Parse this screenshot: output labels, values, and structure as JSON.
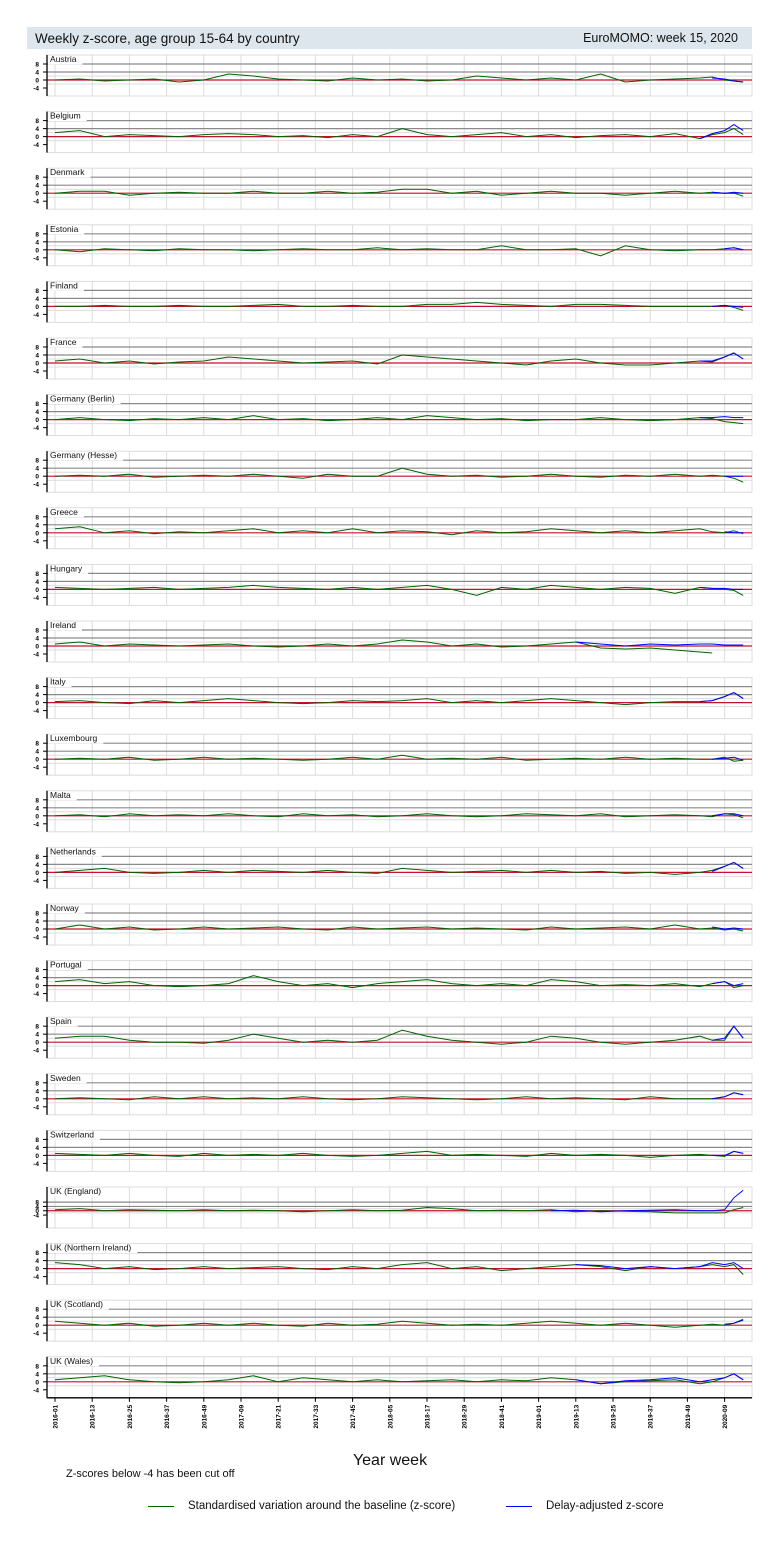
{
  "header": {
    "title": "Weekly z-score, age group 15-64 by country",
    "edition": "EuroMOMO: week 15, 2020"
  },
  "chart_data": {
    "type": "line",
    "title": "Weekly z-score, age group 15-64 by country",
    "xlabel": "Year week",
    "ylabel": "",
    "note": "Z-scores below -4 has been cut off",
    "x_unit": "weeks since 2016-01",
    "x_ticks": [
      {
        "week": 0,
        "label": "2016-01"
      },
      {
        "week": 12,
        "label": "2016-13"
      },
      {
        "week": 24,
        "label": "2016-25"
      },
      {
        "week": 36,
        "label": "2016-37"
      },
      {
        "week": 48,
        "label": "2016-49"
      },
      {
        "week": 60,
        "label": "2017-09"
      },
      {
        "week": 72,
        "label": "2017-21"
      },
      {
        "week": 84,
        "label": "2017-33"
      },
      {
        "week": 96,
        "label": "2017-45"
      },
      {
        "week": 108,
        "label": "2018-05"
      },
      {
        "week": 120,
        "label": "2018-17"
      },
      {
        "week": 132,
        "label": "2018-29"
      },
      {
        "week": 144,
        "label": "2018-41"
      },
      {
        "week": 156,
        "label": "2019-01"
      },
      {
        "week": 168,
        "label": "2019-13"
      },
      {
        "week": 180,
        "label": "2019-25"
      },
      {
        "week": 192,
        "label": "2019-37"
      },
      {
        "week": 204,
        "label": "2019-49"
      },
      {
        "week": 216,
        "label": "2020-09"
      }
    ],
    "y_ticks": [
      8,
      4,
      0,
      -4
    ],
    "ylim": [
      -8,
      12.5
    ],
    "xlim": [
      0,
      224
    ],
    "legend": [
      {
        "name": "Standardised variation around the baseline (z-score)",
        "color": "#006400"
      },
      {
        "name": "Delay-adjusted z-score",
        "color": "#0000ff"
      }
    ],
    "baseline_color": "#c8102e",
    "x": [
      0,
      8,
      16,
      24,
      32,
      40,
      48,
      56,
      64,
      72,
      80,
      88,
      96,
      104,
      112,
      120,
      128,
      136,
      144,
      152,
      160,
      168,
      176,
      184,
      192,
      200,
      208,
      212,
      216,
      219,
      222
    ],
    "panels": [
      {
        "name": "Austria",
        "z": [
          0,
          0.5,
          -0.5,
          0,
          0.5,
          -1,
          0,
          3,
          2,
          0.5,
          0,
          -0.5,
          1,
          0,
          0.5,
          -0.5,
          0,
          2,
          1,
          0,
          1,
          0,
          3,
          -1,
          0,
          0.5,
          1,
          1.5,
          0,
          -0.5,
          -1
        ],
        "delay_start": 27,
        "delay": [
          1,
          0.5,
          -0.5,
          -1
        ]
      },
      {
        "name": "Belgium",
        "z": [
          2,
          3,
          0,
          1,
          0.5,
          0,
          1,
          1.5,
          1,
          0,
          0.5,
          -0.5,
          1,
          0,
          4,
          1,
          0,
          1,
          2,
          0,
          1,
          -0.5,
          0.5,
          1,
          0,
          1.5,
          -1,
          1,
          2,
          4,
          1
        ],
        "delay_start": 26,
        "delay": [
          -1,
          1.5,
          3,
          6,
          3
        ]
      },
      {
        "name": "Denmark",
        "z": [
          0,
          1,
          1,
          -1,
          0,
          0.5,
          0,
          0,
          1,
          0,
          0,
          1,
          0,
          0.5,
          2,
          2,
          0,
          1,
          -1,
          0,
          1,
          0,
          0,
          -1,
          0,
          1,
          0,
          0.5,
          0,
          0,
          -1.5
        ],
        "delay_start": 27,
        "delay": [
          0.5,
          0,
          0.5,
          0
        ]
      },
      {
        "name": "Estonia",
        "z": [
          0,
          -1,
          0.5,
          0,
          -0.5,
          0.5,
          0,
          0,
          -0.5,
          0,
          0.5,
          0,
          0,
          1,
          0,
          0.5,
          0,
          0,
          2,
          0,
          0,
          0.5,
          -3,
          2,
          0,
          -0.5,
          0,
          0,
          0.5,
          1,
          0
        ],
        "delay_start": 28,
        "delay": [
          0.5,
          1,
          0
        ]
      },
      {
        "name": "Finland",
        "z": [
          0,
          0,
          0.5,
          0,
          0,
          0.5,
          0,
          0,
          0.5,
          1,
          0,
          0,
          0.5,
          0,
          0,
          1,
          1,
          2,
          1,
          0.5,
          0,
          1,
          1,
          0.5,
          0,
          0,
          0,
          0,
          0.5,
          -0.5,
          -2
        ],
        "delay_start": 27,
        "delay": [
          0,
          0.5,
          0,
          -0.5
        ]
      },
      {
        "name": "France",
        "z": [
          1,
          2,
          0,
          1,
          -0.5,
          0.5,
          1,
          3,
          2,
          1,
          0,
          0.5,
          1,
          -0.5,
          4,
          3,
          2,
          1,
          0,
          -1,
          1,
          2,
          0,
          -1,
          -1,
          0,
          1,
          0.5,
          3,
          5,
          2
        ],
        "delay_start": 26,
        "delay": [
          1,
          1,
          3,
          5,
          2
        ]
      },
      {
        "name": "Germany (Berlin)",
        "z": [
          0,
          1,
          0,
          -0.5,
          0.5,
          0,
          1,
          0,
          2,
          0,
          0.5,
          -0.5,
          0,
          1,
          0,
          2,
          1,
          0,
          0.5,
          -0.5,
          0,
          0,
          1,
          0,
          -0.5,
          0,
          1,
          0.5,
          -1,
          -1.5,
          -2
        ],
        "delay_start": 26,
        "delay": [
          1,
          1,
          1.5,
          1,
          1
        ]
      },
      {
        "name": "Germany (Hesse)",
        "z": [
          0,
          0.5,
          0,
          1,
          -0.5,
          0,
          0.5,
          0,
          1,
          0,
          -1,
          1,
          0,
          0,
          4,
          1,
          0,
          0.5,
          -0.5,
          0,
          1,
          0,
          -0.5,
          0.5,
          0,
          1,
          0,
          0.5,
          0,
          -1,
          -3
        ],
        "delay_start": 28,
        "delay": [
          0,
          0,
          0
        ]
      },
      {
        "name": "Greece",
        "z": [
          2,
          3,
          0,
          1,
          -0.5,
          0.5,
          0,
          1,
          2,
          0,
          1,
          0,
          2,
          0,
          1,
          0.5,
          -1,
          1,
          0,
          0.5,
          2,
          1,
          0,
          1,
          0,
          1,
          2,
          0.5,
          0,
          1,
          -0.5
        ],
        "delay_start": 28,
        "delay": [
          0.5,
          0,
          0
        ]
      },
      {
        "name": "Hungary",
        "z": [
          1,
          0.5,
          0,
          0.5,
          1,
          0,
          0.5,
          1,
          2,
          1,
          0.5,
          0,
          1,
          0,
          1,
          2,
          0,
          -3,
          1,
          0,
          2,
          1,
          0,
          1,
          0.5,
          -2,
          1,
          0.5,
          0,
          -0.5,
          -3
        ],
        "delay_start": 26,
        "delay": [
          1,
          0.5,
          0.5,
          0,
          0
        ]
      },
      {
        "name": "Ireland",
        "z": [
          1,
          2,
          0,
          1,
          0.5,
          0,
          0.5,
          1,
          0,
          -0.5,
          0,
          1,
          0,
          1,
          3,
          2,
          0,
          1,
          -0.5,
          0,
          1,
          2,
          -1,
          -1.5,
          -1,
          -2,
          -3,
          -3.5,
          null,
          null,
          null
        ],
        "delay_start": 21,
        "delay": [
          2,
          1,
          0,
          1,
          0.5,
          1,
          1,
          0.5,
          0.5,
          0.5
        ]
      },
      {
        "name": "Italy",
        "z": [
          0.5,
          1,
          0,
          -0.5,
          1,
          0,
          1,
          2,
          1,
          0,
          -0.5,
          0,
          1,
          0.5,
          1,
          2,
          0,
          1,
          0,
          1,
          2,
          1,
          0,
          -1,
          0,
          0.5,
          0.5,
          1,
          3,
          5,
          2
        ],
        "delay_start": 26,
        "delay": [
          0.5,
          1,
          3,
          5,
          2
        ]
      },
      {
        "name": "Luxembourg",
        "z": [
          0,
          0.5,
          0,
          1,
          -0.5,
          0,
          1,
          0,
          0.5,
          0,
          -0.5,
          0,
          1,
          0,
          2,
          0,
          0.5,
          0,
          1,
          -0.5,
          0,
          0.5,
          0,
          1,
          0,
          0.5,
          0,
          0,
          1,
          -1,
          -0.5
        ],
        "delay_start": 27,
        "delay": [
          0,
          0.5,
          1,
          -0.5
        ]
      },
      {
        "name": "Malta",
        "z": [
          0,
          0.5,
          -0.5,
          1,
          0,
          0.5,
          0,
          1,
          0,
          -0.5,
          1,
          0,
          0.5,
          -0.5,
          0,
          1,
          0,
          -0.5,
          0,
          1,
          0.5,
          0,
          1,
          -0.5,
          0,
          0.5,
          0,
          -0.5,
          1,
          0.5,
          -1
        ],
        "delay_start": 27,
        "delay": [
          0,
          1,
          1,
          0
        ]
      },
      {
        "name": "Netherlands",
        "z": [
          0,
          1,
          2,
          0,
          -0.5,
          0,
          1,
          0,
          1,
          0.5,
          0,
          1,
          0,
          -0.5,
          2,
          1,
          0,
          0.5,
          1,
          0,
          1,
          0,
          0.5,
          -0.5,
          0,
          -1,
          0,
          1,
          3,
          5,
          2
        ],
        "delay_start": 27,
        "delay": [
          0.5,
          3,
          5,
          2
        ]
      },
      {
        "name": "Norway",
        "z": [
          0,
          2,
          0,
          1,
          -0.5,
          0,
          1,
          0,
          0.5,
          1,
          0,
          -0.5,
          1,
          0,
          0.5,
          1,
          0,
          0.5,
          0,
          -0.5,
          1,
          0,
          0.5,
          1,
          0,
          2,
          0,
          0.5,
          -0.5,
          0,
          -1
        ],
        "delay_start": 27,
        "delay": [
          1,
          0,
          0.5,
          0
        ]
      },
      {
        "name": "Portugal",
        "z": [
          2,
          3,
          1,
          2,
          0,
          -0.5,
          0,
          1,
          5,
          2,
          0,
          1,
          -1,
          1,
          2,
          3,
          1,
          0,
          1,
          0,
          3,
          2,
          0,
          0.5,
          0,
          1,
          -0.5,
          1,
          2,
          -1,
          0
        ],
        "delay_start": 27,
        "delay": [
          1,
          2,
          0,
          1
        ]
      },
      {
        "name": "Spain",
        "z": [
          2,
          3,
          3,
          1,
          0,
          0,
          -0.5,
          1,
          4,
          2,
          0,
          1,
          0,
          1,
          6,
          3,
          1,
          0,
          -1,
          0,
          3,
          2,
          0,
          -1,
          0,
          1,
          3,
          1,
          1,
          8,
          2
        ],
        "delay_start": 27,
        "delay": [
          1,
          2,
          8,
          2
        ]
      },
      {
        "name": "Sweden",
        "z": [
          0,
          0.5,
          0,
          -0.5,
          1,
          0,
          1,
          0,
          0.5,
          0,
          1,
          0,
          -0.5,
          0,
          1,
          0.5,
          0,
          -0.5,
          0,
          1,
          0,
          0.5,
          0,
          -0.5,
          1,
          0,
          0,
          0,
          1,
          3,
          2
        ],
        "delay_start": 27,
        "delay": [
          0,
          1,
          3,
          2
        ]
      },
      {
        "name": "Switzerland",
        "z": [
          1,
          0.5,
          0,
          1,
          0,
          -0.5,
          1,
          0,
          0.5,
          0,
          1,
          0,
          -0.5,
          0,
          1,
          2,
          0,
          0.5,
          0,
          -0.5,
          1,
          0,
          0.5,
          0,
          -1,
          0,
          0.5,
          0,
          -0.5,
          2,
          1
        ],
        "delay_start": 27,
        "delay": [
          0,
          0,
          2,
          1
        ]
      },
      {
        "name": "UK (England)",
        "ylim": [
          -16,
          22
        ],
        "z": [
          1,
          2,
          0,
          1,
          0.5,
          0,
          1,
          0,
          0.5,
          0,
          -1,
          0,
          1,
          0,
          0.5,
          3,
          2,
          0,
          0.5,
          0,
          1,
          -1,
          0,
          -0.5,
          -1,
          -2,
          -2,
          -2,
          -2,
          1,
          3
        ],
        "delay_start": 20,
        "delay": [
          0,
          0.5,
          -1,
          0,
          0.5,
          1,
          0,
          0,
          1,
          12,
          19
        ]
      },
      {
        "name": "UK (Northern Ireland)",
        "z": [
          3,
          2,
          0,
          1,
          -0.5,
          0,
          1,
          0,
          0.5,
          1,
          0,
          -0.5,
          1,
          0,
          2,
          3,
          0,
          1,
          -1,
          0,
          1,
          2,
          1,
          -1,
          1,
          0,
          1,
          2,
          1,
          2,
          -3
        ],
        "delay_start": 21,
        "delay": [
          2,
          1.5,
          0,
          1,
          0,
          1,
          3,
          2,
          3,
          0
        ]
      },
      {
        "name": "UK (Scotland)",
        "z": [
          2,
          1,
          0,
          1,
          -0.5,
          0,
          1,
          0,
          1,
          0,
          -0.5,
          1,
          0,
          0.5,
          2,
          1,
          0,
          0.5,
          0,
          1,
          2,
          1,
          0,
          1,
          0,
          -1,
          0,
          0.5,
          0,
          1,
          3
        ],
        "delay_start": 28,
        "delay": [
          0.5,
          1,
          2.5
        ]
      },
      {
        "name": "UK (Wales)",
        "z": [
          1,
          2,
          3,
          1,
          0,
          -0.5,
          0,
          1,
          3,
          0,
          2,
          1,
          0,
          1,
          0,
          0.5,
          1,
          0,
          1,
          0.5,
          2,
          1,
          -1,
          0,
          0.5,
          1,
          -1,
          0,
          2,
          4,
          1
        ],
        "delay_start": 21,
        "delay": [
          1,
          -1,
          0.5,
          1,
          2,
          0,
          1,
          2,
          4,
          1
        ]
      }
    ]
  }
}
